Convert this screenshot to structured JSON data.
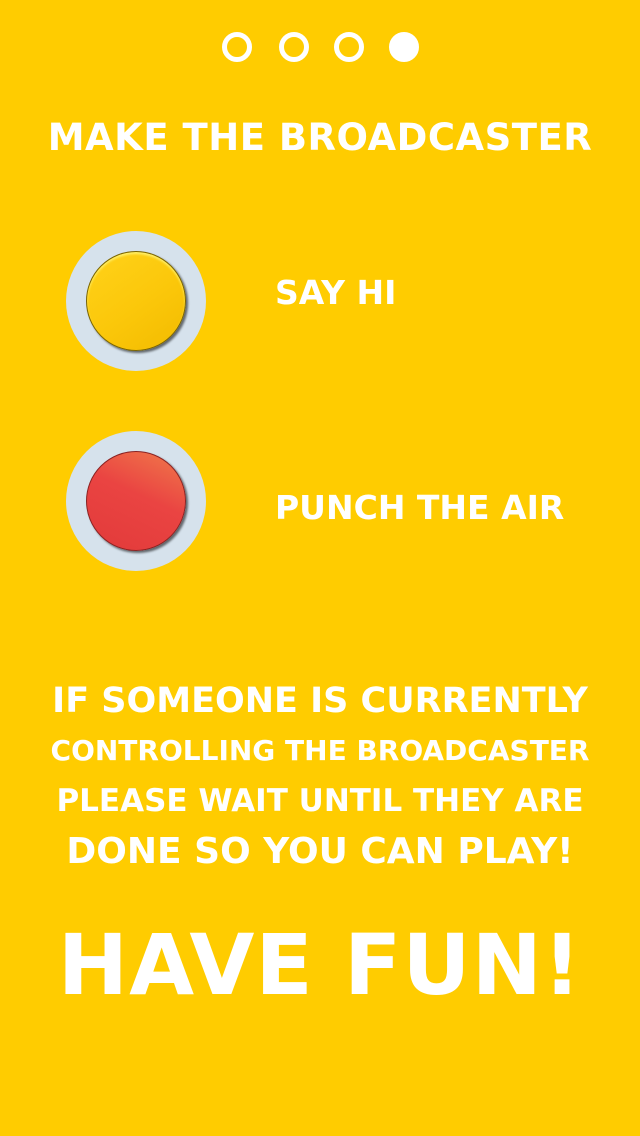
{
  "colors": {
    "background": "#FFCC00",
    "text": "#FFFFFF",
    "ring": "#D6E2EC",
    "yellow_button": "#FBC70A",
    "red_button": "#EA4442"
  },
  "pager": {
    "page_count": 4,
    "current_page": 4
  },
  "title": "MAKE THE BROADCASTER",
  "actions": [
    {
      "label": "SAY HI",
      "color": "yellow"
    },
    {
      "label": "PUNCH THE AIR",
      "color": "red"
    }
  ],
  "notice": {
    "line1": "IF SOMEONE IS CURRENTLY",
    "line2": "CONTROLLING THE BROADCASTER",
    "line3": "PLEASE WAIT UNTIL THEY ARE",
    "line4": "DONE SO YOU CAN PLAY!"
  },
  "closing": "HAVE FUN!"
}
